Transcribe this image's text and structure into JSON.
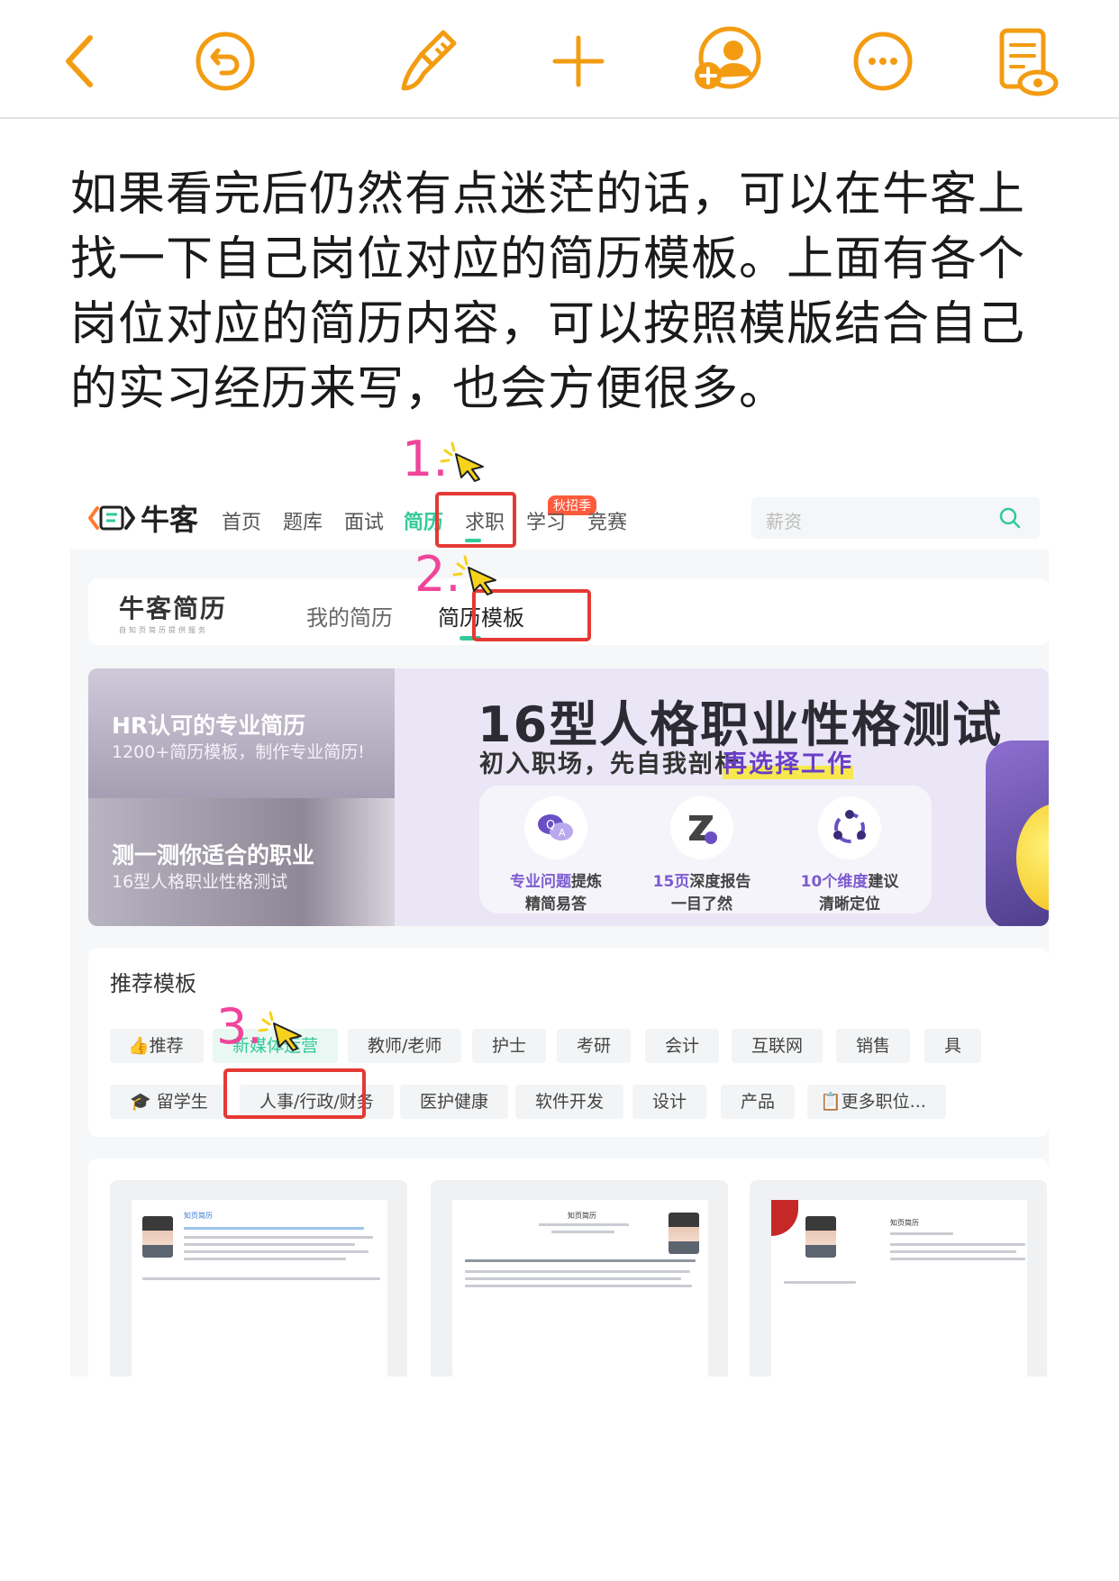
{
  "toolbar": {
    "icons": [
      "back-icon",
      "undo-icon",
      "brush-icon",
      "add-icon",
      "add-user-icon",
      "more-icon",
      "preview-icon"
    ],
    "accent": "#f39c12"
  },
  "article": {
    "text": "如果看完后仍然有点迷茫的话，可以在牛客上找一下自己岗位对应的简历模板。上面有各个岗位对应的简历内容，可以按照模版结合自己的实习经历来写，也会方便很多。"
  },
  "annotations": {
    "step1": "1.",
    "step2": "2.",
    "step3": "3."
  },
  "site": {
    "logo": "牛客",
    "nav": [
      "首页",
      "题库",
      "面试",
      "简历",
      "求职",
      "学习",
      "竞赛"
    ],
    "badge": "秋招季",
    "search_placeholder": "薪资",
    "brand": "牛客简历",
    "brand_slogan": "自知页简历提供服务",
    "tabs": [
      "我的简历",
      "简历模板"
    ],
    "accent": "#32ca99"
  },
  "banner": {
    "left_title_1": "HR认可的专业简历",
    "left_sub_1": "1200+简历模板，制作专业简历!",
    "left_title_2": "测一测你适合的职业",
    "left_sub_2": "16型人格职业性格测试",
    "title": "16型人格职业性格测试",
    "subtitle": "初入职场，先自我剖析，",
    "subtitle_highlight": "再选择工作",
    "features": [
      {
        "hl": "专业问题",
        "rest": "提炼",
        "line2": "精简易答"
      },
      {
        "hl": "15页",
        "rest": "深度报告",
        "line2": "一目了然"
      },
      {
        "hl": "10个维度",
        "rest": "建议",
        "line2": "清晰定位"
      }
    ]
  },
  "recommend": {
    "title": "推荐模板",
    "row1": [
      "推荐",
      "新媒体运营",
      "教师/老师",
      "护士",
      "考研",
      "会计",
      "互联网",
      "销售",
      "具"
    ],
    "row2": [
      "留学生",
      "人事/行政/财务",
      "医护健康",
      "软件开发",
      "设计",
      "产品",
      "更多职位..."
    ]
  },
  "templates": [
    {
      "name": "知页简历"
    },
    {
      "name": "知页简历"
    },
    {
      "name": "知页简历"
    }
  ]
}
